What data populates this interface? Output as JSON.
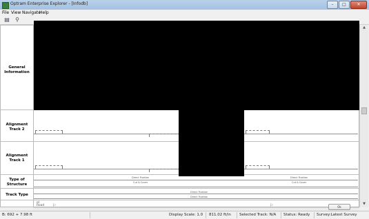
{
  "window": {
    "title": "Optram Enterprise Explorer - [Infodb]"
  },
  "menu": {
    "items": [
      "File",
      "View",
      "Navigate",
      "Help"
    ]
  },
  "toolbar": {
    "icons": [
      "open-icon",
      "zoom-icon"
    ]
  },
  "rows": {
    "general": "General Information",
    "track2": "Alignment Track 2",
    "track1": "Alignment Track 1",
    "structure": "Type of Structure",
    "tracktype": "Track Type"
  },
  "overlays": {
    "direct_fixation": "Direct Fixation",
    "cut_cover": "Cut & Cover",
    "open": "Direct Fixation"
  },
  "footer": {
    "mile_label": "ol",
    "road_label": "Road",
    "ok_label": "Ok"
  },
  "status": {
    "coords": "B: 692 + 7.98 ft",
    "display_scale": "Display Scale: 1.0",
    "distance": "811.02 ft/in",
    "selected_track": "Selected Track: N/A",
    "state": "Status: Ready",
    "survey": "Survey:Latest Survey"
  }
}
